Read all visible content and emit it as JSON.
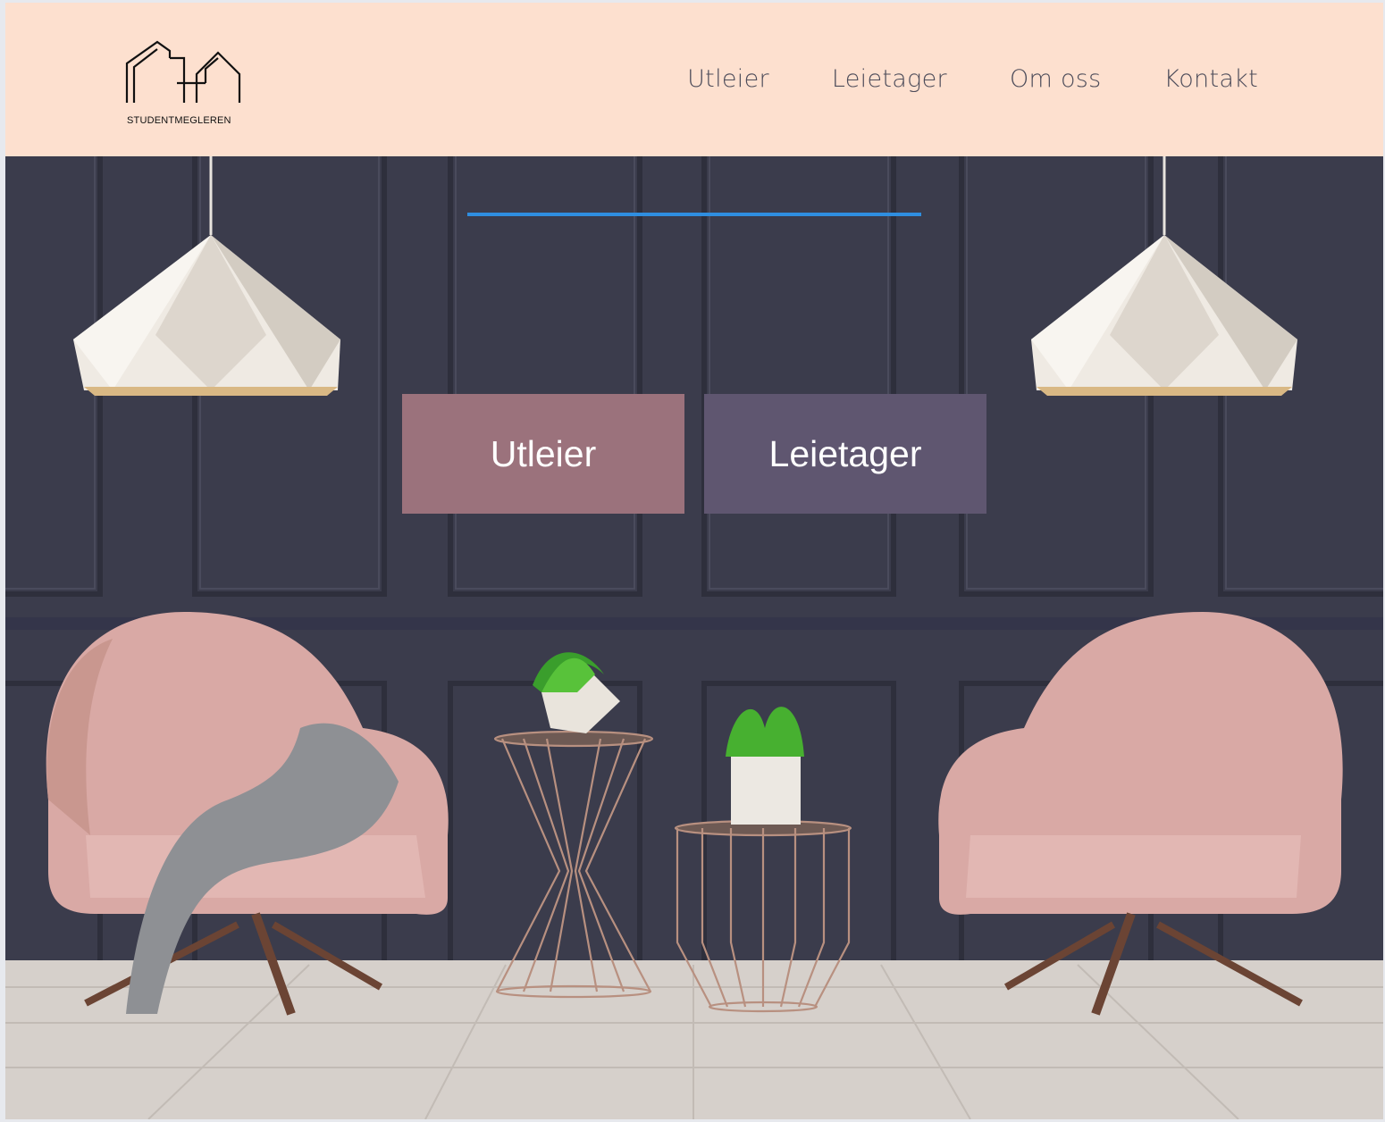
{
  "brand": {
    "name": "STUDENTMEGLEREN",
    "logo_icon": "house-outline-logo"
  },
  "nav": {
    "items": [
      "Utleier",
      "Leietager",
      "Om oss",
      "Kontakt"
    ]
  },
  "hero": {
    "accent_color": "#2f8ee0",
    "primary_button": "Utleier",
    "secondary_button": "Leietager"
  },
  "colors": {
    "header_bg": "#fde0cf",
    "utleier_button": "#9b727c",
    "leietager_button": "#5f5670",
    "wall": "#3c3d4d"
  }
}
